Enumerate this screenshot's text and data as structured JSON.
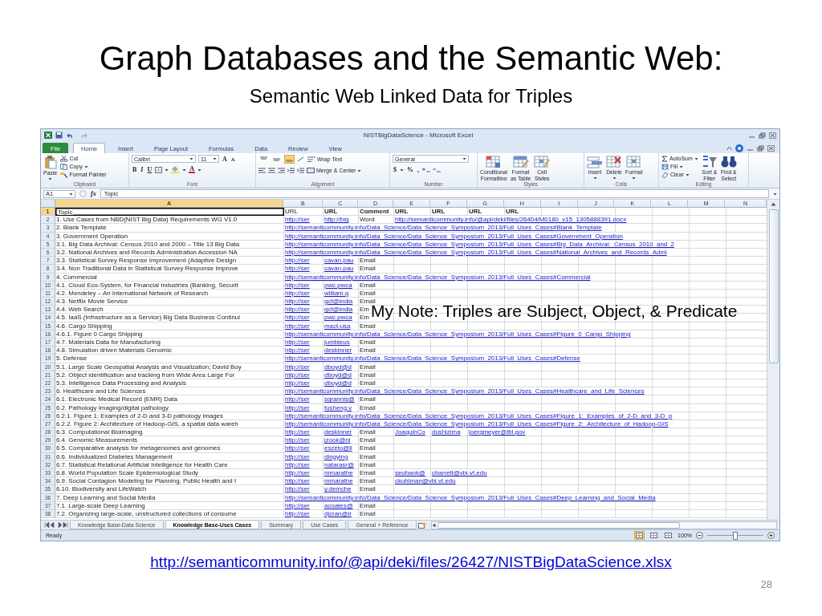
{
  "slide": {
    "title": "Graph Databases and the Semantic Web:",
    "subtitle": "Semantic Web Linked Data for Triples",
    "note": "My Note: Triples are Subject, Object, & Predicate",
    "link": "http://semanticommunity.info/@api/deki/files/26427/NISTBigDataScience.xlsx",
    "page_number": "28"
  },
  "excel": {
    "window": {
      "title": "NISTBigDataScience - Microsoft Excel"
    },
    "tabs": [
      {
        "label": "File",
        "kind": "file",
        "selected": false
      },
      {
        "label": "Home",
        "kind": "tab",
        "selected": true
      },
      {
        "label": "Insert",
        "kind": "tab",
        "selected": false
      },
      {
        "label": "Page Layout",
        "kind": "tab",
        "selected": false
      },
      {
        "label": "Formulas",
        "kind": "tab",
        "selected": false
      },
      {
        "label": "Data",
        "kind": "tab",
        "selected": false
      },
      {
        "label": "Review",
        "kind": "tab",
        "selected": false
      },
      {
        "label": "View",
        "kind": "tab",
        "selected": false
      }
    ],
    "ribbon": [
      {
        "kind": "clipboard",
        "label": "Clipboard",
        "paste": "Paste",
        "cut": "Cut",
        "copy": "Copy",
        "format_painter": "Format Painter"
      },
      {
        "kind": "font",
        "label": "Font",
        "font_name": "Calibri",
        "font_size": "11",
        "grow": "A",
        "shrink": "A",
        "styles": [
          "B",
          "I",
          "U"
        ],
        "font_color": "A"
      },
      {
        "kind": "alignment",
        "label": "Alignment",
        "vertical_align": [
          {
            "selected": false
          },
          {
            "selected": false
          },
          {
            "selected": true
          }
        ],
        "wrap": "Wrap Text",
        "merge": "Merge & Center"
      },
      {
        "kind": "number",
        "label": "Number",
        "format": "General",
        "currency": "$",
        "percent": "%",
        "comma": ","
      },
      {
        "kind": "styles",
        "label": "Styles",
        "buttons": [
          [
            "Conditional",
            "Formatting"
          ],
          [
            "Format",
            "as Table"
          ],
          [
            "Cell",
            "Styles"
          ]
        ]
      },
      {
        "kind": "cells",
        "label": "Cells",
        "buttons": [
          "Insert",
          "Delete",
          "Format"
        ]
      },
      {
        "kind": "editing",
        "label": "Editing",
        "autosum": "AutoSum",
        "fill": "Fill",
        "clear": "Clear",
        "sort": [
          "Sort &",
          "Filter"
        ],
        "find": [
          "Find &",
          "Select"
        ]
      }
    ],
    "formula_bar": {
      "cell": "A1",
      "fx": "fx",
      "value": "Topic"
    },
    "columns": [
      {
        "label": "A",
        "selected": true
      },
      {
        "label": "B",
        "selected": false
      },
      {
        "label": "C",
        "selected": false
      },
      {
        "label": "D",
        "selected": false
      },
      {
        "label": "E",
        "selected": false
      },
      {
        "label": "F",
        "selected": false
      },
      {
        "label": "G",
        "selected": false
      },
      {
        "label": "H",
        "selected": false
      },
      {
        "label": "I",
        "selected": false
      },
      {
        "label": "J",
        "selected": false
      },
      {
        "label": "K",
        "selected": false
      },
      {
        "label": "L",
        "selected": false
      },
      {
        "label": "M",
        "selected": false
      },
      {
        "label": "N",
        "selected": false
      }
    ],
    "rows": [
      {
        "number": "1",
        "selected": true,
        "cells": [
          {
            "kind": "text",
            "text": "Topic"
          },
          {
            "kind": "text",
            "text": "URL"
          },
          {
            "kind": "heading",
            "text": "URL"
          },
          {
            "kind": "heading",
            "text": "Comment"
          },
          {
            "kind": "heading",
            "text": "URL"
          },
          {
            "kind": "heading",
            "text": "URL"
          },
          {
            "kind": "heading",
            "text": "URL"
          },
          {
            "kind": "heading",
            "text": "URL"
          }
        ]
      },
      {
        "number": "2",
        "selected": false,
        "cells": [
          {
            "kind": "text",
            "text": "1. Use Cases from NBD(NIST Big Data) Requirements WG V1.0"
          },
          {
            "kind": "link",
            "text": "http://ser"
          },
          {
            "kind": "link",
            "text": "http://big"
          },
          {
            "kind": "text",
            "text": "Word"
          },
          {
            "kind": "link",
            "text": "http://semanticommunity.info/@api/deki/files/26404/M0180_v15_1305888391.docx"
          }
        ]
      },
      {
        "number": "3",
        "selected": false,
        "cells": [
          {
            "kind": "text",
            "text": "2. Blank Template"
          },
          {
            "kind": "link",
            "text": "http://semanticommunity.info/Data_Science/Data_Science_Symposium_2013/Full_Uses_Cases#Blank_Template"
          }
        ]
      },
      {
        "number": "4",
        "selected": false,
        "cells": [
          {
            "kind": "text",
            "text": "3. Government Operation"
          },
          {
            "kind": "link",
            "text": "http://semanticommunity.info/Data_Science/Data_Science_Symposium_2013/Full_Uses_Cases#Government_Operation"
          }
        ]
      },
      {
        "number": "5",
        "selected": false,
        "cells": [
          {
            "kind": "text",
            "text": "3.1. Big Data Archival: Census 2010 and 2000 – Title 13 Big Data"
          },
          {
            "kind": "link",
            "text": "http://semanticommunity.info/Data_Science/Data_Science_Symposium_2013/Full_Uses_Cases#Big_Data_Archival:_Census_2010_and_2"
          }
        ]
      },
      {
        "number": "6",
        "selected": false,
        "cells": [
          {
            "kind": "text",
            "text": "3.2. National Archives and Records Administration Accession NA"
          },
          {
            "kind": "link",
            "text": "http://semanticommunity.info/Data_Science/Data_Science_Symposium_2013/Full_Uses_Cases#National_Archives_and_Records_Admi"
          }
        ]
      },
      {
        "number": "7",
        "selected": false,
        "cells": [
          {
            "kind": "text",
            "text": "3.3. Statistical Survey Response Improvement (Adaptive Design"
          },
          {
            "kind": "link",
            "text": "http://ser"
          },
          {
            "kind": "link",
            "text": "cavan.pau"
          },
          {
            "kind": "text",
            "text": "Email"
          }
        ]
      },
      {
        "number": "8",
        "selected": false,
        "cells": [
          {
            "kind": "text",
            "text": "3.4. Non Traditional Data in Statistical Survey Response Improve"
          },
          {
            "kind": "link",
            "text": "http://ser"
          },
          {
            "kind": "link",
            "text": "cavan.pau"
          },
          {
            "kind": "text",
            "text": "Email"
          }
        ]
      },
      {
        "number": "9",
        "selected": false,
        "cells": [
          {
            "kind": "text",
            "text": "4. Commercial"
          },
          {
            "kind": "link",
            "text": "http://semanticommunity.info/Data_Science/Data_Science_Symposium_2013/Full_Uses_Cases#Commercial"
          }
        ]
      },
      {
        "number": "10",
        "selected": false,
        "cells": [
          {
            "kind": "text",
            "text": "4.1. Cloud Eco-System, for Financial Industries (Banking, Securit"
          },
          {
            "kind": "link",
            "text": "http://ser"
          },
          {
            "kind": "link",
            "text": "pwc.pwca"
          },
          {
            "kind": "text",
            "text": "Email"
          }
        ]
      },
      {
        "number": "11",
        "selected": false,
        "cells": [
          {
            "kind": "text",
            "text": "4.2. Mendeley – An International Network of Research"
          },
          {
            "kind": "link",
            "text": "http://ser"
          },
          {
            "kind": "link",
            "text": "william.g"
          },
          {
            "kind": "text",
            "text": "Email"
          }
        ]
      },
      {
        "number": "12",
        "selected": false,
        "cells": [
          {
            "kind": "text",
            "text": "4.3. Netflix Movie Service"
          },
          {
            "kind": "link",
            "text": "http://ser"
          },
          {
            "kind": "link",
            "text": "gcf@india"
          },
          {
            "kind": "text",
            "text": "Email"
          }
        ]
      },
      {
        "number": "13",
        "selected": false,
        "cells": [
          {
            "kind": "text",
            "text": "4.4. Web Search"
          },
          {
            "kind": "link",
            "text": "http://ser"
          },
          {
            "kind": "link",
            "text": "gcf@india"
          },
          {
            "kind": "text",
            "text": "Em"
          }
        ]
      },
      {
        "number": "14",
        "selected": false,
        "cells": [
          {
            "kind": "text",
            "text": "4.5. IaaS (Infrastructure as a Service) Big Data Business Continui"
          },
          {
            "kind": "link",
            "text": "http://ser"
          },
          {
            "kind": "link",
            "text": "pwc.pwca"
          },
          {
            "kind": "text",
            "text": "Em"
          }
        ]
      },
      {
        "number": "15",
        "selected": false,
        "cells": [
          {
            "kind": "text",
            "text": "4.6. Cargo Shipping"
          },
          {
            "kind": "link",
            "text": "http://ser"
          },
          {
            "kind": "link",
            "text": "mact-usa"
          },
          {
            "kind": "text",
            "text": "Email"
          }
        ]
      },
      {
        "number": "16",
        "selected": false,
        "cells": [
          {
            "kind": "text",
            "text": "4.6.1. Figure 0 Cargo Shipping"
          },
          {
            "kind": "link",
            "text": "http://semanticommunity.info/Data_Science/Data_Science_Symposium_2013/Full_Uses_Cases#Figure_0_Cargo_Shipping"
          }
        ]
      },
      {
        "number": "17",
        "selected": false,
        "cells": [
          {
            "kind": "text",
            "text": "4.7. Materials Data for Manufacturing"
          },
          {
            "kind": "link",
            "text": "http://ser"
          },
          {
            "kind": "link",
            "text": "jumbleus"
          },
          {
            "kind": "text",
            "text": "Email"
          }
        ]
      },
      {
        "number": "18",
        "selected": false,
        "cells": [
          {
            "kind": "text",
            "text": "4.8. Simulation driven Materials Genomic"
          },
          {
            "kind": "link",
            "text": "http://ser"
          },
          {
            "kind": "link",
            "text": "deskinner"
          },
          {
            "kind": "text",
            "text": "Email"
          }
        ]
      },
      {
        "number": "19",
        "selected": false,
        "cells": [
          {
            "kind": "text",
            "text": "5. Defense"
          },
          {
            "kind": "link",
            "text": "http://semanticommunity.info/Data_Science/Data_Science_Symposium_2013/Full_Uses_Cases#Defense"
          }
        ]
      },
      {
        "number": "20",
        "selected": false,
        "cells": [
          {
            "kind": "text",
            "text": "5.1. Large Scale Geospatial Analysis and Visualization; David Boy"
          },
          {
            "kind": "link",
            "text": "http://ser"
          },
          {
            "kind": "link",
            "text": "dboyd@d"
          },
          {
            "kind": "text",
            "text": "Email"
          }
        ]
      },
      {
        "number": "21",
        "selected": false,
        "cells": [
          {
            "kind": "text",
            "text": "5.2. Object identification and tracking from Wide Area Large For"
          },
          {
            "kind": "link",
            "text": "http://ser"
          },
          {
            "kind": "link",
            "text": "dboyd@d"
          },
          {
            "kind": "text",
            "text": "Email"
          }
        ]
      },
      {
        "number": "22",
        "selected": false,
        "cells": [
          {
            "kind": "text",
            "text": "5.3. Intelligence Data Processing and Analysis"
          },
          {
            "kind": "link",
            "text": "http://ser"
          },
          {
            "kind": "link",
            "text": "dboyd@d"
          },
          {
            "kind": "text",
            "text": "Email"
          }
        ]
      },
      {
        "number": "23",
        "selected": false,
        "cells": [
          {
            "kind": "text",
            "text": "6. Healthcare and Life Sciences"
          },
          {
            "kind": "link",
            "text": "http://semanticommunity.info/Data_Science/Data_Science_Symposium_2013/Full_Uses_Cases#Healthcare_and_Life_Sciences"
          }
        ]
      },
      {
        "number": "24",
        "selected": false,
        "cells": [
          {
            "kind": "text",
            "text": "6.1. Electronic Medical Record (EMR) Data"
          },
          {
            "kind": "link",
            "text": "http://ser"
          },
          {
            "kind": "link",
            "text": "sgrannis@"
          },
          {
            "kind": "text",
            "text": "Email"
          }
        ]
      },
      {
        "number": "25",
        "selected": false,
        "cells": [
          {
            "kind": "text",
            "text": "6.2. Pathology Imaging/digital pathology"
          },
          {
            "kind": "link",
            "text": "http://ser"
          },
          {
            "kind": "link",
            "text": "fusheng.v"
          },
          {
            "kind": "text",
            "text": "Email"
          }
        ]
      },
      {
        "number": "26",
        "selected": false,
        "cells": [
          {
            "kind": "text",
            "text": "6.2.1. Figure 1: Examples of 2-D and 3-D pathology images"
          },
          {
            "kind": "link",
            "text": "http://semanticommunity.info/Data_Science/Data_Science_Symposium_2013/Full_Uses_Cases#Figure_1:_Examples_of_2-D_and_3-D_p"
          }
        ]
      },
      {
        "number": "27",
        "selected": false,
        "cells": [
          {
            "kind": "text",
            "text": "6.2.2. Figure 2: Architecture of Hadoop-GIS, a spatial data wareh"
          },
          {
            "kind": "link",
            "text": "http://semanticommunity.info/Data_Science/Data_Science_Symposium_2013/Full_Uses_Cases#Figure_2:_Architecture_of_Hadoop-GIS"
          }
        ]
      },
      {
        "number": "28",
        "selected": false,
        "cells": [
          {
            "kind": "text",
            "text": "6.3. Computational Bioimaging"
          },
          {
            "kind": "link",
            "text": "http://ser"
          },
          {
            "kind": "link",
            "text": "deskinner"
          },
          {
            "kind": "text",
            "text": "Email"
          },
          {
            "kind": "link",
            "text": "JoaquinCo"
          },
          {
            "kind": "link",
            "text": "dushizima"
          },
          {
            "kind": "link",
            "text": "joergmeyer@lbl.gov"
          }
        ]
      },
      {
        "number": "29",
        "selected": false,
        "cells": [
          {
            "kind": "text",
            "text": "6.4. Genomic Measurements"
          },
          {
            "kind": "link",
            "text": "http://ser"
          },
          {
            "kind": "link",
            "text": "jzook@ni"
          },
          {
            "kind": "text",
            "text": "Email"
          }
        ]
      },
      {
        "number": "30",
        "selected": false,
        "cells": [
          {
            "kind": "text",
            "text": "6.5. Comparative analysis for metagenomes and genomes"
          },
          {
            "kind": "link",
            "text": "http://ser"
          },
          {
            "kind": "link",
            "text": "eszeto@ll"
          },
          {
            "kind": "text",
            "text": "Email"
          }
        ]
      },
      {
        "number": "31",
        "selected": false,
        "cells": [
          {
            "kind": "text",
            "text": "6.6. Individualized Diabetes Management"
          },
          {
            "kind": "link",
            "text": "http://ser"
          },
          {
            "kind": "link",
            "text": "dingying"
          },
          {
            "kind": "text",
            "text": "Email"
          }
        ]
      },
      {
        "number": "32",
        "selected": false,
        "cells": [
          {
            "kind": "text",
            "text": "6.7. Statistical Relational Artificial Intelligence for Health Care"
          },
          {
            "kind": "link",
            "text": "http://ser"
          },
          {
            "kind": "link",
            "text": "natarasr@"
          },
          {
            "kind": "text",
            "text": "Email"
          }
        ]
      },
      {
        "number": "33",
        "selected": false,
        "cells": [
          {
            "kind": "text",
            "text": "6.8. World Population Scale Epidemiological Study"
          },
          {
            "kind": "link",
            "text": "http://ser"
          },
          {
            "kind": "link",
            "text": "mmarathe"
          },
          {
            "kind": "text",
            "text": "Email"
          },
          {
            "kind": "link",
            "text": "seubank@"
          },
          {
            "kind": "link",
            "text": "cbarrett@vbi.vt.edu"
          }
        ]
      },
      {
        "number": "34",
        "selected": false,
        "cells": [
          {
            "kind": "text",
            "text": "6.9. Social Contagion Modeling  for Planning, Public Health and I"
          },
          {
            "kind": "link",
            "text": "http://ser"
          },
          {
            "kind": "link",
            "text": "mmarathe"
          },
          {
            "kind": "text",
            "text": "Email"
          },
          {
            "kind": "link",
            "text": "ckuhlman@vbi.vt.edu"
          }
        ]
      },
      {
        "number": "35",
        "selected": false,
        "cells": [
          {
            "kind": "text",
            "text": "6.10. Biodiversity and LifeWatch"
          },
          {
            "kind": "link",
            "text": "http://ser"
          },
          {
            "kind": "link",
            "text": "y.demche"
          },
          {
            "kind": "text",
            "text": "Email"
          }
        ]
      },
      {
        "number": "36",
        "selected": false,
        "cells": [
          {
            "kind": "text",
            "text": "7. Deep Learning and Social Media"
          },
          {
            "kind": "link",
            "text": "http://semanticommunity.info/Data_Science/Data_Science_Symposium_2013/Full_Uses_Cases#Deep_Learning_and_Social_Media"
          }
        ]
      },
      {
        "number": "37",
        "selected": false,
        "cells": [
          {
            "kind": "text",
            "text": "7.1. Large-scale Deep Learning"
          },
          {
            "kind": "link",
            "text": "http://ser"
          },
          {
            "kind": "link",
            "text": "acoates@"
          },
          {
            "kind": "text",
            "text": "Email"
          }
        ]
      },
      {
        "number": "38",
        "selected": false,
        "cells": [
          {
            "kind": "text",
            "text": "7.2. Organizing large-scale, unstructured collections of consume"
          },
          {
            "kind": "link",
            "text": "http://ser"
          },
          {
            "kind": "link",
            "text": "djcran@ir"
          },
          {
            "kind": "text",
            "text": "Email"
          }
        ]
      }
    ],
    "sheet_tabs": [
      {
        "label": "Knowledge Base-Data Science",
        "selected": false
      },
      {
        "label": "Knowledge Base-Uses Cases",
        "selected": true
      },
      {
        "label": "Summary",
        "selected": false
      },
      {
        "label": "Use Cases",
        "selected": false
      },
      {
        "label": "General + Reference",
        "selected": false
      }
    ],
    "status_bar": {
      "status": "Ready",
      "views": [
        {
          "selected": true
        },
        {
          "selected": false
        },
        {
          "selected": false
        }
      ],
      "zoom": "100%",
      "zoom_slider": {
        "level": 0.5
      }
    }
  }
}
